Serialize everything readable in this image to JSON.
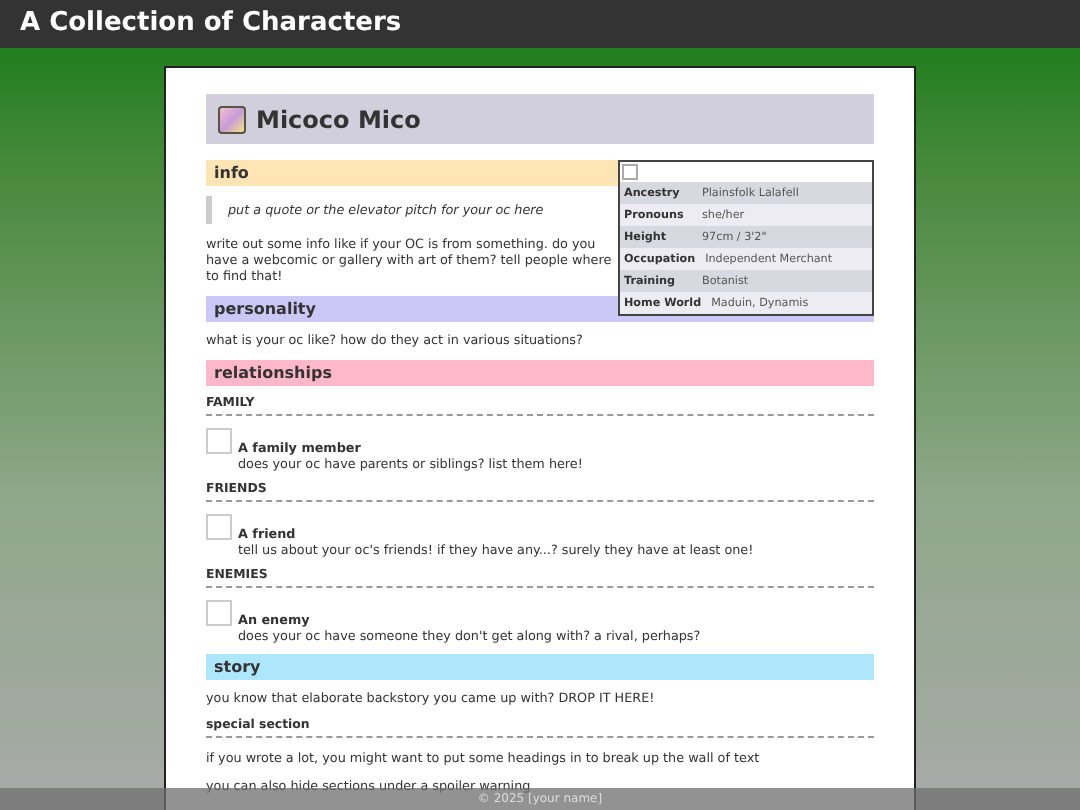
{
  "site_title": "A Collection of Characters",
  "character": {
    "name": "Micoco Mico"
  },
  "profile": [
    {
      "label": "Ancestry",
      "value": "Plainsfolk Lalafell"
    },
    {
      "label": "Pronouns",
      "value": "she/her"
    },
    {
      "label": "Height",
      "value": "97cm / 3'2\""
    },
    {
      "label": "Occupation",
      "value": "Independent Merchant"
    },
    {
      "label": "Training",
      "value": "Botanist"
    },
    {
      "label": "Home World",
      "value": "Maduin, Dynamis"
    }
  ],
  "sections": [
    {
      "title": "info",
      "color": "#ffe5b4",
      "blocks": [
        {
          "kind": "quote",
          "text": "put a quote or the elevator pitch for your oc here"
        },
        {
          "kind": "paragraph",
          "text": "write out some info like if your OC is from something. do you have a webcomic or gallery with art of them? tell people where to find that!"
        }
      ]
    },
    {
      "title": "personality",
      "color": "#cbc7f7",
      "blocks": [
        {
          "kind": "paragraph",
          "text": "what is your oc like? how do they act in various situations?"
        }
      ]
    },
    {
      "title": "relationships",
      "color": "#ffb8c9",
      "blocks": [
        {
          "kind": "subheading",
          "text": "FAMILY"
        },
        {
          "kind": "person",
          "name": "A family member",
          "text": "does your oc have parents or siblings? list them here!"
        },
        {
          "kind": "subheading",
          "text": "FRIENDS"
        },
        {
          "kind": "person",
          "name": "A friend",
          "text": "tell us about your oc's friends! if they have any...? surely they have at least one!"
        },
        {
          "kind": "subheading",
          "text": "ENEMIES"
        },
        {
          "kind": "person",
          "name": "An enemy",
          "text": "does your oc have someone they don't get along with? a rival, perhaps?"
        }
      ]
    },
    {
      "title": "story",
      "color": "#aee7fb",
      "blocks": [
        {
          "kind": "paragraph",
          "text": "you know that elaborate backstory you came up with? DROP IT HERE!"
        },
        {
          "kind": "subheading",
          "text": "special section"
        },
        {
          "kind": "paragraph",
          "text": "if you wrote a lot, you might want to put some headings in to break up the wall of text"
        },
        {
          "kind": "paragraph",
          "text": "you can also hide sections under a spoiler warning"
        }
      ]
    }
  ],
  "footer": "© 2025 [your name]"
}
